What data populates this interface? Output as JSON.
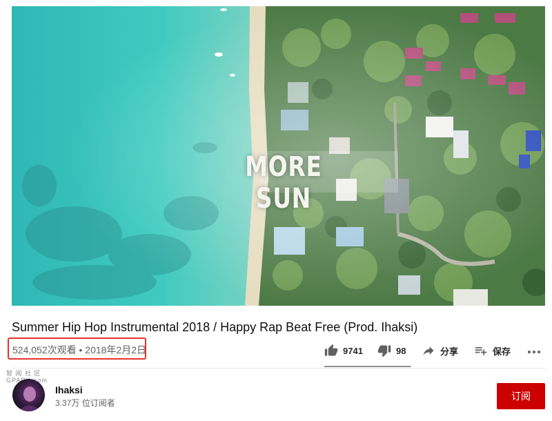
{
  "player": {
    "overlay_text": "MORE SUN"
  },
  "video": {
    "title": "Summer Hip Hop Instrumental 2018 / Happy Rap Beat Free (Prod. Ihaksi)",
    "views": "524,052次观看",
    "separator": "•",
    "date": "2018年2月2日"
  },
  "actions": {
    "like_count": "9741",
    "dislike_count": "98",
    "share_label": "分享",
    "save_label": "保存",
    "like_ratio": 0.99
  },
  "watermark": {
    "line1": "智 阅 社 区",
    "line2": "GPARK·com"
  },
  "channel": {
    "name": "Ihaksi",
    "subscribers": "3.37万 位订阅者",
    "subscribe_label": "订阅"
  },
  "colors": {
    "subscribe": "#cc0000",
    "highlight": "#e5322b",
    "secondary_text": "#606060"
  },
  "icons": [
    "thumb-up-icon",
    "thumb-down-icon",
    "share-icon",
    "playlist-add-icon",
    "more-icon"
  ]
}
